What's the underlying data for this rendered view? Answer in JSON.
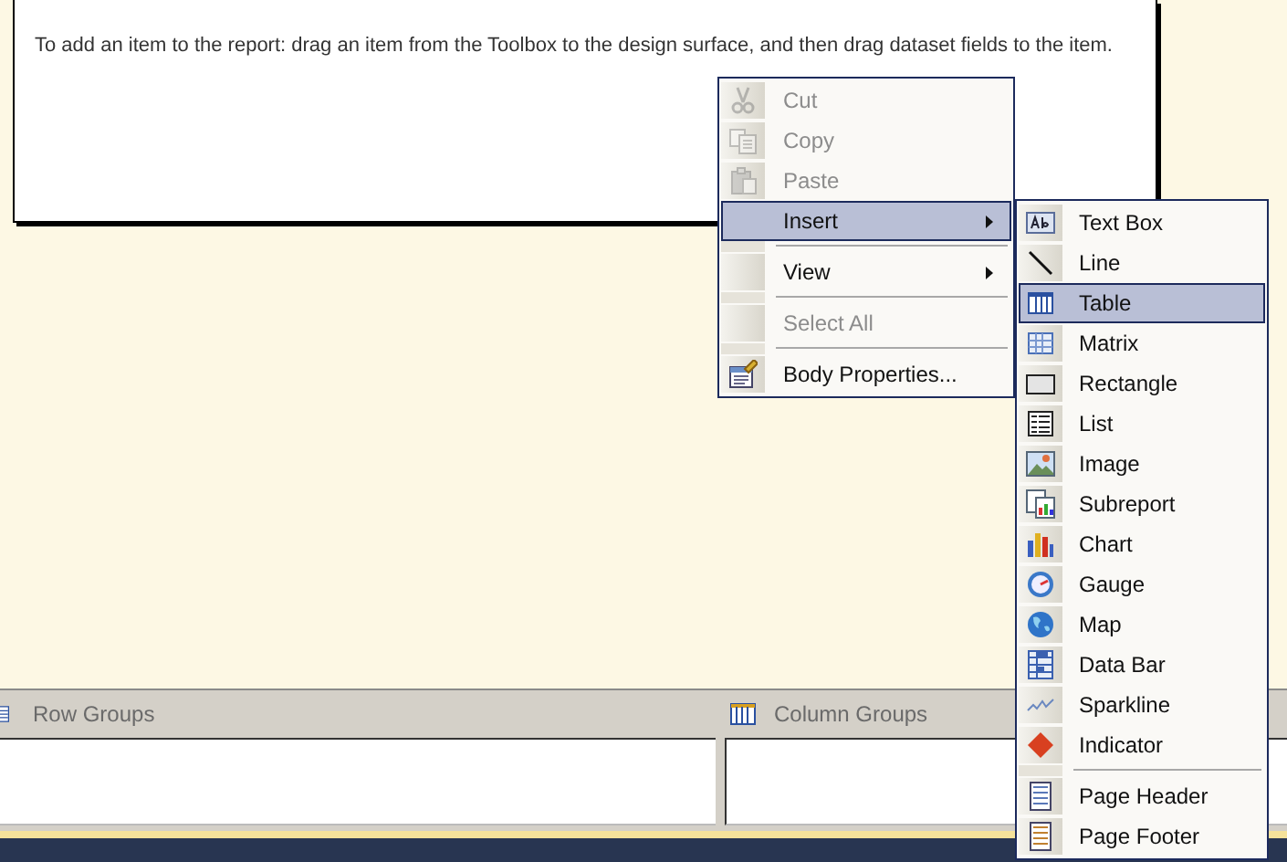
{
  "report_body": {
    "hint": "To add an item to the report: drag an item from the Toolbox to the design surface, and then drag dataset fields to the item."
  },
  "context_menu": {
    "items": [
      {
        "kind": "item",
        "label": "Cut",
        "disabled": true,
        "selected": false,
        "submenu": false
      },
      {
        "kind": "item",
        "label": "Copy",
        "disabled": true,
        "selected": false,
        "submenu": false
      },
      {
        "kind": "item",
        "label": "Paste",
        "disabled": true,
        "selected": false,
        "submenu": false
      },
      {
        "kind": "item",
        "label": "Insert",
        "disabled": false,
        "selected": true,
        "submenu": true
      },
      {
        "kind": "separator"
      },
      {
        "kind": "item",
        "label": "View",
        "disabled": false,
        "selected": false,
        "submenu": true
      },
      {
        "kind": "separator"
      },
      {
        "kind": "item",
        "label": "Select All",
        "disabled": true,
        "selected": false,
        "submenu": false
      },
      {
        "kind": "separator"
      },
      {
        "kind": "item",
        "label": "Body Properties...",
        "disabled": false,
        "selected": false,
        "submenu": false
      }
    ]
  },
  "insert_submenu": {
    "items": [
      {
        "kind": "item",
        "label": "Text Box",
        "selected": false
      },
      {
        "kind": "item",
        "label": "Line",
        "selected": false
      },
      {
        "kind": "item",
        "label": "Table",
        "selected": true
      },
      {
        "kind": "item",
        "label": "Matrix",
        "selected": false
      },
      {
        "kind": "item",
        "label": "Rectangle",
        "selected": false
      },
      {
        "kind": "item",
        "label": "List",
        "selected": false
      },
      {
        "kind": "item",
        "label": "Image",
        "selected": false
      },
      {
        "kind": "item",
        "label": "Subreport",
        "selected": false
      },
      {
        "kind": "item",
        "label": "Chart",
        "selected": false
      },
      {
        "kind": "item",
        "label": "Gauge",
        "selected": false
      },
      {
        "kind": "item",
        "label": "Map",
        "selected": false
      },
      {
        "kind": "item",
        "label": "Data Bar",
        "selected": false
      },
      {
        "kind": "item",
        "label": "Sparkline",
        "selected": false
      },
      {
        "kind": "item",
        "label": "Indicator",
        "selected": false
      },
      {
        "kind": "separator"
      },
      {
        "kind": "item",
        "label": "Page Header",
        "selected": false
      },
      {
        "kind": "item",
        "label": "Page Footer",
        "selected": false
      }
    ]
  },
  "grouping_pane": {
    "row_groups": "Row Groups",
    "column_groups": "Column Groups"
  }
}
